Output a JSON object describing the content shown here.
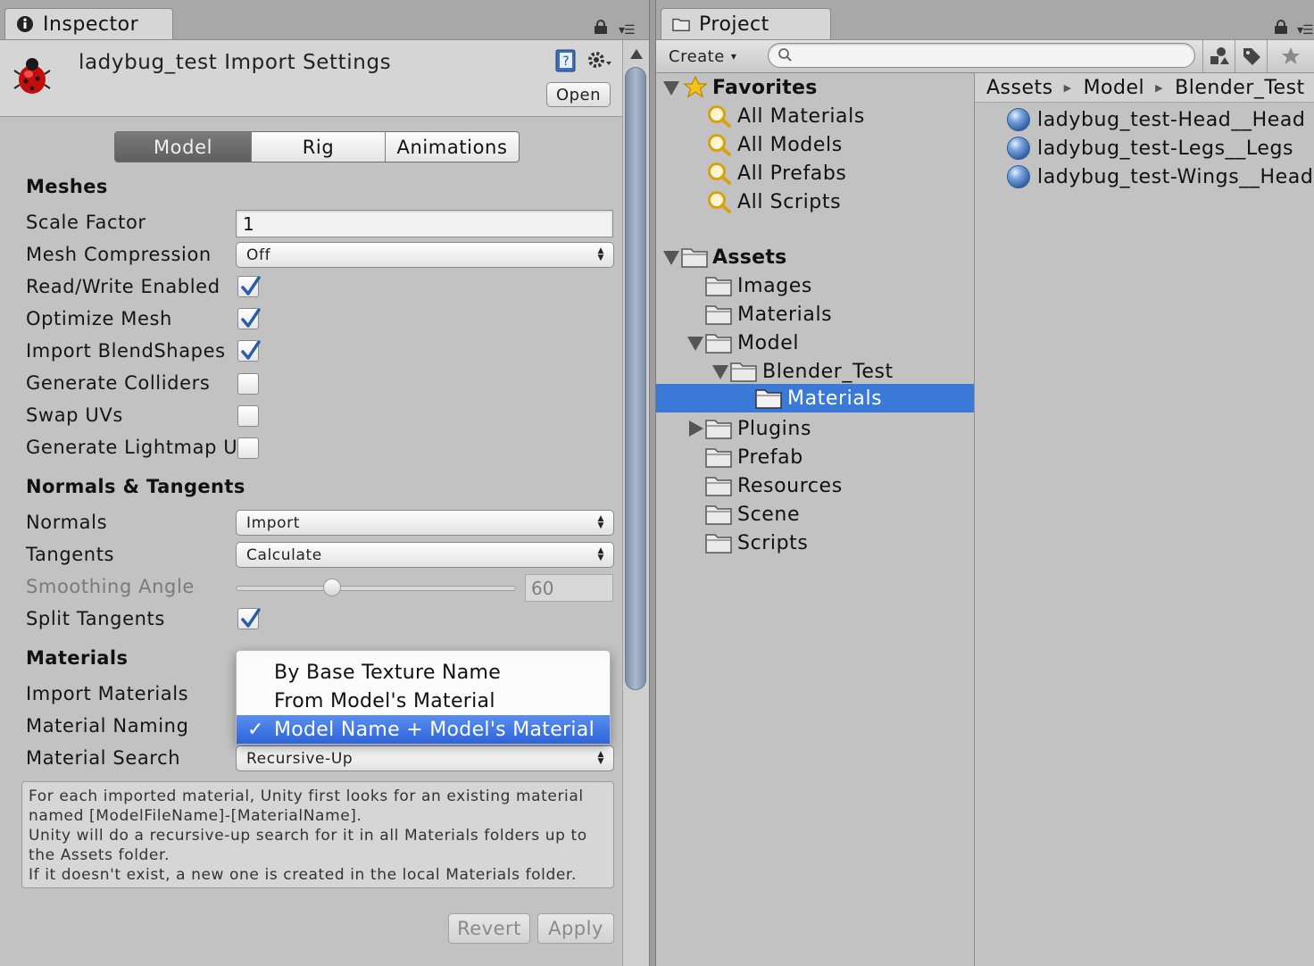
{
  "inspector": {
    "tab_label": "Inspector",
    "header_title": "ladybug_test Import Settings",
    "open_button": "Open",
    "tabs": [
      {
        "label": "Model",
        "active": true
      },
      {
        "label": "Rig",
        "active": false
      },
      {
        "label": "Animations",
        "active": false
      }
    ],
    "meshes": {
      "title": "Meshes",
      "scale_factor": {
        "label": "Scale Factor",
        "value": "1"
      },
      "mesh_compression": {
        "label": "Mesh Compression",
        "value": "Off"
      },
      "read_write": {
        "label": "Read/Write Enabled",
        "checked": true
      },
      "optimize_mesh": {
        "label": "Optimize Mesh",
        "checked": true
      },
      "import_blendshapes": {
        "label": "Import BlendShapes",
        "checked": true
      },
      "generate_colliders": {
        "label": "Generate Colliders",
        "checked": false
      },
      "swap_uvs": {
        "label": "Swap UVs",
        "checked": false
      },
      "generate_lightmap": {
        "label": "Generate Lightmap UV",
        "checked": false
      }
    },
    "normals_tangents": {
      "title": "Normals & Tangents",
      "normals": {
        "label": "Normals",
        "value": "Import"
      },
      "tangents": {
        "label": "Tangents",
        "value": "Calculate"
      },
      "smoothing_angle": {
        "label": "Smoothing Angle",
        "value": "60",
        "slider_fraction": 0.333
      },
      "split_tangents": {
        "label": "Split Tangents",
        "checked": true
      }
    },
    "materials": {
      "title": "Materials",
      "import_materials": {
        "label": "Import Materials"
      },
      "material_naming": {
        "label": "Material Naming"
      },
      "material_search": {
        "label": "Material Search",
        "value": "Recursive-Up"
      },
      "naming_options": [
        {
          "label": "By Base Texture Name",
          "selected": false
        },
        {
          "label": "From Model's Material",
          "selected": false
        },
        {
          "label": "Model Name + Model's Material",
          "selected": true
        }
      ],
      "selected_check": "✓"
    },
    "help_lines": [
      "For each imported material, Unity first looks for an existing material",
      "named [ModelFileName]-[MaterialName].",
      "Unity will do a recursive-up search for it in all Materials folders up to",
      "the Assets folder.",
      "If it doesn't exist, a new one is created in the local Materials folder."
    ],
    "revert_button": "Revert",
    "apply_button": "Apply"
  },
  "project": {
    "tab_label": "Project",
    "create_button": "Create",
    "create_arrow": "▾",
    "search_placeholder": "",
    "favorites": {
      "label": "Favorites",
      "items": [
        "All Materials",
        "All Models",
        "All Prefabs",
        "All Scripts"
      ]
    },
    "assets_root": "Assets",
    "folders": {
      "images": "Images",
      "materials": "Materials",
      "model": "Model",
      "blender_test": "Blender_Test",
      "blender_materials": "Materials",
      "plugins": "Plugins",
      "prefab": "Prefab",
      "resources": "Resources",
      "scene": "Scene",
      "scripts": "Scripts"
    },
    "breadcrumb": [
      "Assets",
      "Model",
      "Blender_Test"
    ],
    "breadcrumb_sep": "▶",
    "assets": [
      "ladybug_test-Head__Head",
      "ladybug_test-Legs__Legs",
      "ladybug_test-Wings__Head"
    ]
  },
  "colors": {
    "selection": "#3a79d7",
    "panel_bg": "#c2c2c2"
  }
}
